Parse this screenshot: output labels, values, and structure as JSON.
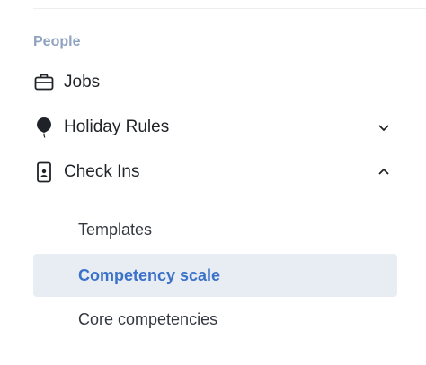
{
  "sidebar": {
    "section_heading": "People",
    "items": [
      {
        "label": "Jobs",
        "icon": "briefcase-icon",
        "expandable": false
      },
      {
        "label": "Holiday Rules",
        "icon": "balloon-icon",
        "expandable": true,
        "expanded": false
      },
      {
        "label": "Check Ins",
        "icon": "phone-badge-icon",
        "expandable": true,
        "expanded": true
      }
    ],
    "check_ins_subitems": [
      {
        "label": "Templates",
        "active": false
      },
      {
        "label": "Competency scale",
        "active": true
      },
      {
        "label": "Core competencies",
        "active": false
      }
    ]
  },
  "colors": {
    "heading": "#8fa3c1",
    "text": "#1f2328",
    "active_text": "#3a72c8",
    "active_bg": "#e8ecf3"
  }
}
